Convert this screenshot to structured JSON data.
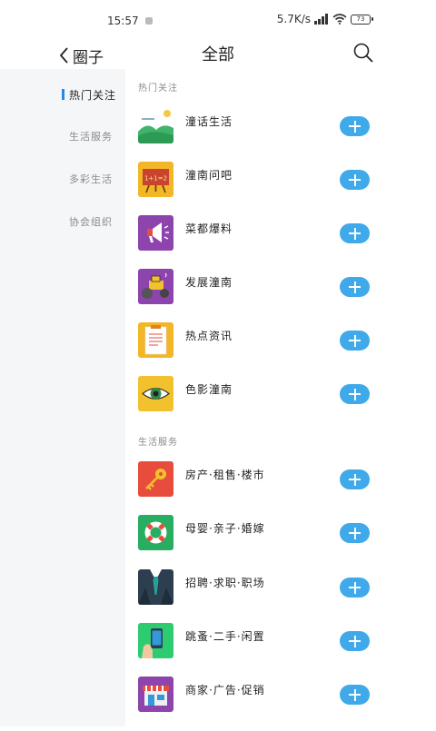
{
  "status_bar": {
    "time": "15:57",
    "network_speed": "5.7K/s",
    "battery": "73",
    "icons": [
      "notification-icon",
      "signal-icon",
      "wifi-icon",
      "battery-icon"
    ]
  },
  "header": {
    "back_label": "圈子",
    "title": "全部",
    "icons": [
      "chevron-left-icon",
      "search-icon"
    ]
  },
  "sidebar": {
    "items": [
      {
        "label": "热门关注",
        "active": true
      },
      {
        "label": "生活服务",
        "active": false
      },
      {
        "label": "多彩生活",
        "active": false
      },
      {
        "label": "协会组织",
        "active": false
      }
    ]
  },
  "main": {
    "sections": [
      {
        "title": "热门关注",
        "items": [
          {
            "label": "潼话生活",
            "icon": "landscape-icon"
          },
          {
            "label": "潼南问吧",
            "icon": "blackboard-icon"
          },
          {
            "label": "菜都爆料",
            "icon": "megaphone-icon"
          },
          {
            "label": "发展潼南",
            "icon": "road-roller-icon"
          },
          {
            "label": "热点资讯",
            "icon": "clipboard-icon"
          },
          {
            "label": "色影潼南",
            "icon": "eye-icon"
          }
        ]
      },
      {
        "title": "生活服务",
        "items": [
          {
            "label": "房产·租售·楼市",
            "icon": "key-icon"
          },
          {
            "label": "母婴·亲子·婚嫁",
            "icon": "lifebuoy-icon"
          },
          {
            "label": "招聘·求职·职场",
            "icon": "suit-tie-icon"
          },
          {
            "label": "跳蚤·二手·闲置",
            "icon": "phone-in-hand-icon"
          },
          {
            "label": "商家·广告·促销",
            "icon": "storefront-icon"
          }
        ]
      }
    ],
    "add_button_icon": "plus-icon"
  },
  "colors": {
    "accent": "#3fa9ea",
    "sidebar_bg": "#f5f6f8",
    "active_marker": "#1f8ae8"
  }
}
